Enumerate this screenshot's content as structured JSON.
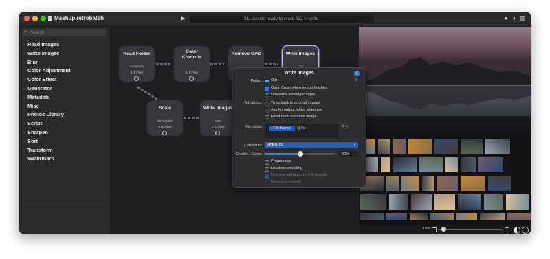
{
  "window": {
    "title": "Mashup.retrobatch",
    "status_text": "311 assets ready to read, 622 to write."
  },
  "sidebar": {
    "search_placeholder": "Search",
    "items": [
      {
        "label": "Read Images"
      },
      {
        "label": "Write Images"
      },
      {
        "label": "Blur"
      },
      {
        "label": "Color Adjustment"
      },
      {
        "label": "Color Effect"
      },
      {
        "label": "Generator"
      },
      {
        "label": "Metadata"
      },
      {
        "label": "Misc"
      },
      {
        "label": "Photos Library"
      },
      {
        "label": "Script"
      },
      {
        "label": "Sharpen"
      },
      {
        "label": "Sort"
      },
      {
        "label": "Transform"
      },
      {
        "label": "Watermark"
      }
    ]
  },
  "nodes": {
    "read_folder": {
      "title": "Read Folder",
      "sub": "Unsplash",
      "files": "311 Files"
    },
    "color_controls": {
      "title": "Color\nControls",
      "sub": "",
      "files": "311 Files"
    },
    "remove_gps": {
      "title": "Remove GPS",
      "sub": "",
      "files": "311 Files"
    },
    "write_images_1": {
      "title": "Write Images",
      "sub": "Out",
      "files": "311 Files"
    },
    "scale": {
      "title": "Scale",
      "sub": "50% scale",
      "files": "311 Files"
    },
    "write_images_2": {
      "title": "Write Images",
      "sub": "Out",
      "files": "311 Files"
    }
  },
  "inspector": {
    "title": "Write Images",
    "folder_label": "Folder:",
    "folder_value": "Out",
    "open_folder": {
      "label": "Open folder when export finishes",
      "checked": true
    },
    "overwrite": {
      "label": "Overwrite existing images",
      "checked": false
    },
    "advanced_label": "Advanced:",
    "write_back": {
      "label": "Write back to original images",
      "checked": false
    },
    "ask_output": {
      "label": "Ask for output folder when run",
      "checked": false
    },
    "read_back": {
      "label": "Read back encoded image",
      "checked": false
    },
    "filename_label": "File name:",
    "filename_token": "File Name",
    "filename_suffix": "@2x",
    "convert_label": "Convert to:",
    "convert_value": "JPEG-XL",
    "quality_label": "Quality / Comp.",
    "quality_value": "50%",
    "quality_fraction": 0.5,
    "progressive": {
      "label": "Progressive",
      "checked": false
    },
    "lossless": {
      "label": "Lossless encoding",
      "checked": false
    },
    "remove_alpha": {
      "label": "Remove alpha channel if opaque",
      "checked": true
    },
    "embed_thumb": {
      "label": "Embed thumbnail",
      "checked": false
    }
  },
  "preview": {
    "zoom_label": "10%",
    "zoom_fraction": 0.04
  },
  "colors": {
    "accent": "#3a7bea",
    "window_bg": "#242427",
    "node_bg": "#38383c"
  }
}
